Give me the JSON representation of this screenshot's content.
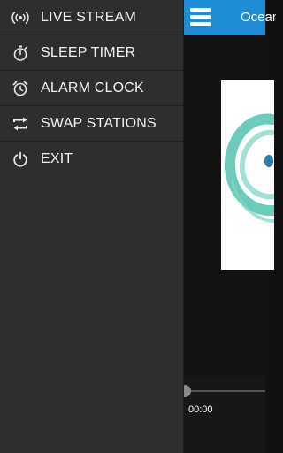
{
  "app": {
    "title": "Ocean",
    "time_elapsed": "00:00",
    "header_color": "#1f8dd6"
  },
  "drawer": {
    "items": [
      {
        "label": "LIVE STREAM",
        "icon": "broadcast-icon"
      },
      {
        "label": "SLEEP TIMER",
        "icon": "stopwatch-icon"
      },
      {
        "label": "ALARM CLOCK",
        "icon": "alarm-clock-icon"
      },
      {
        "label": "SWAP STATIONS",
        "icon": "swap-arrows-icon"
      },
      {
        "label": "EXIT",
        "icon": "power-icon"
      }
    ]
  },
  "colors": {
    "drawer_bg": "#2e2e2e",
    "logo_teal": "#5cc6b4"
  }
}
